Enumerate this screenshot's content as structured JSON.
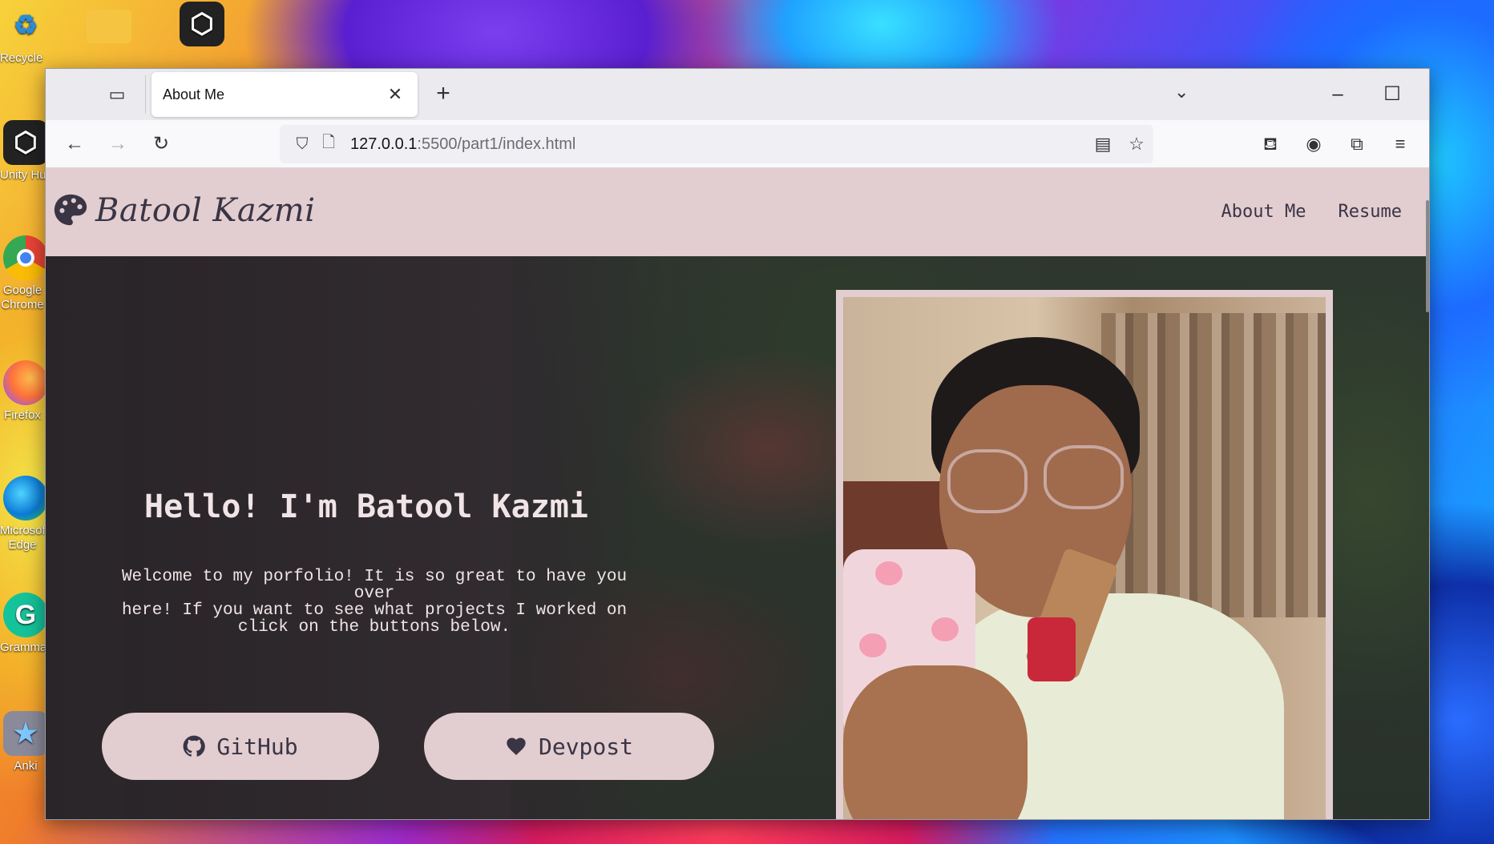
{
  "desktop": {
    "icons": [
      {
        "label": "Recycle Bin",
        "icon": "recycle-bin-icon"
      },
      {
        "label": "",
        "icon": "folder-icon"
      },
      {
        "label": "",
        "icon": "unity-icon"
      },
      {
        "label": "Unity Hub",
        "icon": "unity-hub-icon"
      },
      {
        "label": "Google Chrome",
        "icon": "chrome-icon"
      },
      {
        "label": "Firefox",
        "icon": "firefox-icon"
      },
      {
        "label": "Microsoft Edge",
        "icon": "edge-icon"
      },
      {
        "label": "Grammarly",
        "icon": "grammarly-icon"
      },
      {
        "label": "Anki",
        "icon": "anki-icon"
      }
    ]
  },
  "browser": {
    "tab": {
      "title": "About Me"
    },
    "url": {
      "host": "127.0.0.1",
      "path": ":5500/part1/index.html"
    }
  },
  "site": {
    "logo_text": "Batool Kazmi",
    "nav": [
      "About Me",
      "Resume"
    ],
    "hero": {
      "title": "Hello! I'm Batool Kazmi",
      "text_lines": [
        "Welcome to my porfolio! It is so great to have you over",
        "here! If you want to see what projects I worked on",
        "click on the buttons below."
      ],
      "buttons": [
        {
          "label": "GitHub",
          "icon": "github-icon"
        },
        {
          "label": "Devpost",
          "icon": "heart-icon"
        }
      ]
    }
  },
  "colors": {
    "header_bg": "#e2cdd0",
    "text_dark": "#3a3545",
    "hero_text": "#f1e4e6"
  }
}
